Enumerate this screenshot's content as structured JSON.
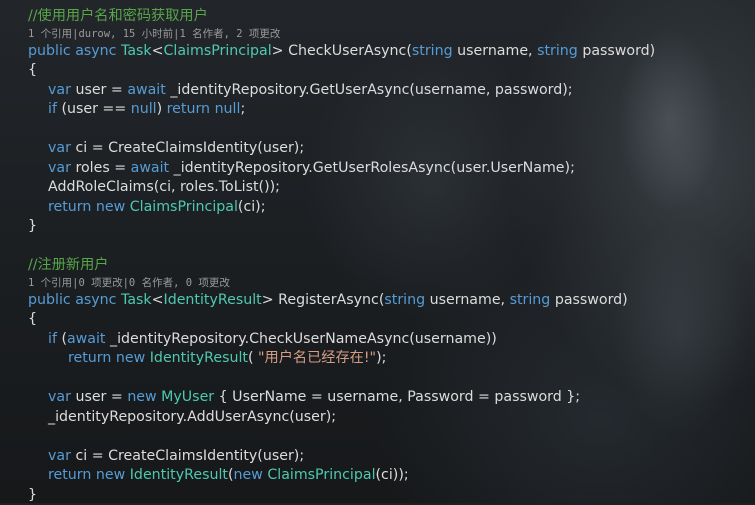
{
  "block1": {
    "comment": "//使用用户名和密码获取用户",
    "codelens": "1 个引用|durow, 15 小时前|1 名作者, 2 项更改",
    "sig": {
      "public": "public",
      "async": "async",
      "task": "Task",
      "lt": "<",
      "claims_principal": "ClaimsPrincipal",
      "gt": ">",
      "method": " CheckUserAsync(",
      "string1": "string",
      "p1": " username, ",
      "string2": "string",
      "p2": " password)"
    },
    "open_brace": "{",
    "l1": {
      "var": "var",
      "a": " user = ",
      "await": "await",
      "b": " _identityRepository.GetUserAsync(username, password);"
    },
    "l2": {
      "if": "if",
      "a": " (user == ",
      "null1": "null",
      "b": ") ",
      "return": "return",
      "c": " ",
      "null2": "null",
      "d": ";"
    },
    "l3": {
      "var": "var",
      "a": " ci = CreateClaimsIdentity(user);"
    },
    "l4": {
      "var": "var",
      "a": " roles = ",
      "await": "await",
      "b": " _identityRepository.GetUserRolesAsync(user.UserName);"
    },
    "l5": {
      "a": "AddRoleClaims(ci, roles.ToList());"
    },
    "l6": {
      "return": "return",
      "new": "new",
      "type": "ClaimsPrincipal",
      "a": "(ci);"
    },
    "close_brace": "}"
  },
  "block2": {
    "comment": "//注册新用户",
    "codelens": "1 个引用|0 项更改|0 名作者, 0 项更改",
    "sig": {
      "public": "public",
      "async": "async",
      "task": "Task",
      "lt": "<",
      "identity_result": "IdentityResult",
      "gt": ">",
      "method": " RegisterAsync(",
      "string1": "string",
      "p1": " username, ",
      "string2": "string",
      "p2": " password)"
    },
    "open_brace": "{",
    "l1": {
      "if": "if",
      "a": " (",
      "await": "await",
      "b": " _identityRepository.CheckUserNameAsync(username))"
    },
    "l2": {
      "return": "return",
      "new": "new",
      "type": "IdentityResult",
      "a": "( ",
      "str": "\"用户名已经存在!\"",
      "b": ");"
    },
    "l3": {
      "var": "var",
      "a": " user = ",
      "new": "new",
      "type": "MyUser",
      "b": " { UserName = username, Password = password };"
    },
    "l4": {
      "a": "_identityRepository.AddUserAsync(user);"
    },
    "l5": {
      "var": "var",
      "a": " ci = CreateClaimsIdentity(user);"
    },
    "l6": {
      "return": "return",
      "new1": "new",
      "type1": "IdentityResult",
      "a": "(",
      "new2": "new",
      "type2": "ClaimsPrincipal",
      "b": "(ci));"
    },
    "close_brace": "}"
  },
  "colors": {
    "keyword": "#569cd6",
    "type": "#4ec9b0",
    "comment": "#57a64a",
    "string": "#d69d85",
    "text": "#dcdcdc",
    "codelens": "#9a9a9a"
  }
}
